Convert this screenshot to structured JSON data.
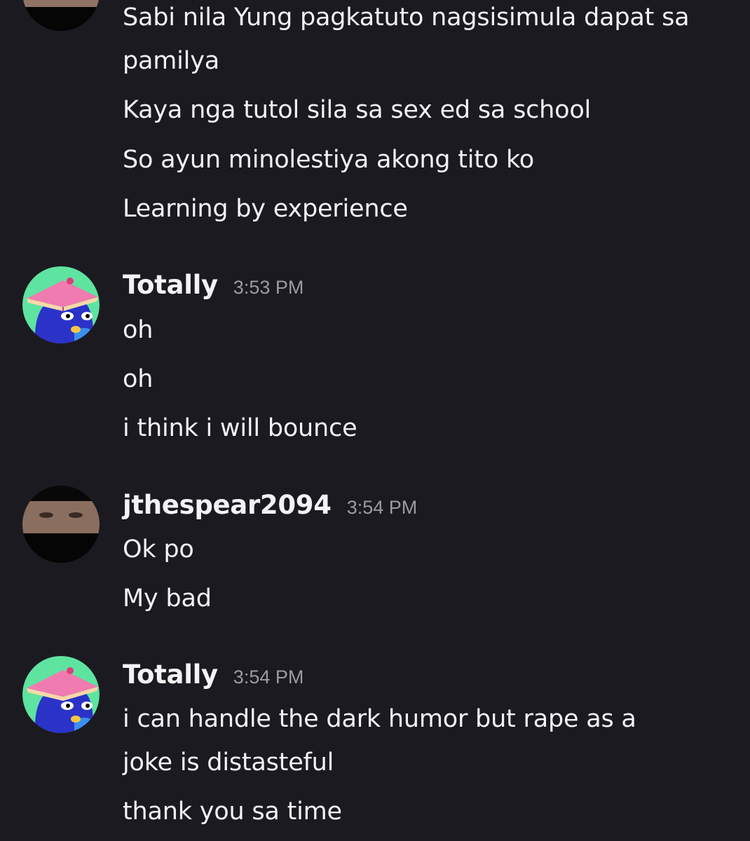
{
  "messages": [
    {
      "username": "",
      "timestamp": "",
      "avatar": "redacted-face-avatar",
      "lines": [
        "Sabi nila Yung pagkatuto nagsisimula dapat sa pamilya",
        "Kaya nga tutol sila sa sex ed sa school",
        "So ayun minolestiya akong tito ko",
        "Learning by experience"
      ]
    },
    {
      "username": "Totally",
      "timestamp": "3:53 PM",
      "avatar": "blue-bird-book-avatar",
      "lines": [
        "oh",
        "oh",
        "i think i will bounce"
      ]
    },
    {
      "username": "jthespear2094",
      "timestamp": "3:54 PM",
      "avatar": "redacted-face-avatar",
      "lines": [
        "Ok po",
        "My bad"
      ]
    },
    {
      "username": "Totally",
      "timestamp": "3:54 PM",
      "avatar": "blue-bird-book-avatar",
      "lines": [
        "i can handle the dark humor but rape as a joke is distasteful",
        "thank you sa time"
      ]
    }
  ],
  "colors": {
    "background": "#1b1a20",
    "text": "#f2f3f5",
    "timestamp": "#9a9ba3",
    "avatar_green": "#5fe3a1",
    "avatar_blue": "#2b32c8",
    "avatar_pink": "#f07bb0"
  }
}
